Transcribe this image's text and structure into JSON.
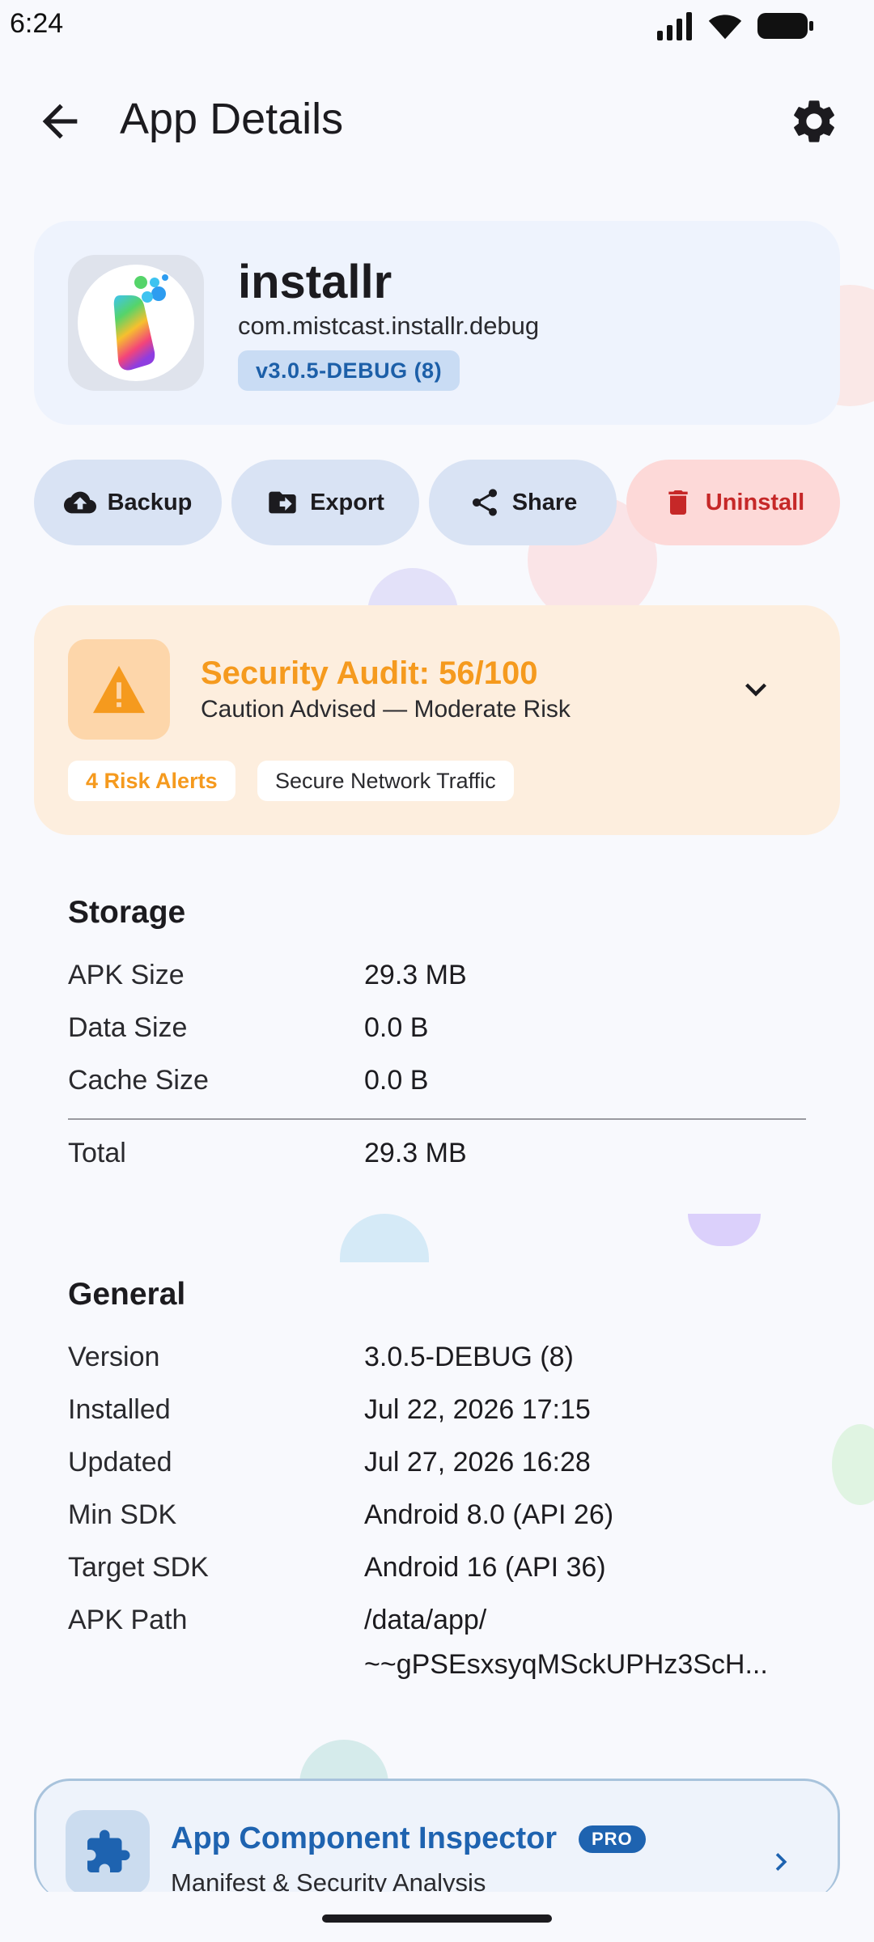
{
  "status_bar": {
    "time": "6:24"
  },
  "app_bar": {
    "title": "App Details",
    "back_icon": "arrow-back-icon",
    "settings_icon": "gear-icon"
  },
  "app": {
    "name": "installr",
    "package": "com.mistcast.installr.debug",
    "version_badge": "v3.0.5-DEBUG (8)"
  },
  "actions": [
    {
      "label": "Backup",
      "icon": "cloud-upload-icon"
    },
    {
      "label": "Export",
      "icon": "folder-export-icon"
    },
    {
      "label": "Share",
      "icon": "share-icon"
    },
    {
      "label": "Uninstall",
      "icon": "trash-icon",
      "color": "#c62828"
    }
  ],
  "security": {
    "title": "Security Audit: 56/100",
    "subtitle": "Caution Advised — Moderate Risk",
    "chips": [
      "4 Risk Alerts",
      "Secure Network Traffic"
    ],
    "accent": "#f59a1e"
  },
  "storage": {
    "title": "Storage",
    "rows": [
      {
        "label": "APK Size",
        "value": "29.3 MB"
      },
      {
        "label": "Data Size",
        "value": "0.0 B"
      },
      {
        "label": "Cache Size",
        "value": "0.0 B"
      }
    ],
    "total": {
      "label": "Total",
      "value": "29.3 MB"
    }
  },
  "general": {
    "title": "General",
    "rows": [
      {
        "label": "Version",
        "value": "3.0.5-DEBUG (8)"
      },
      {
        "label": "Installed",
        "value": "Jul 22, 2026 17:15"
      },
      {
        "label": "Updated",
        "value": "Jul 27, 2026 16:28"
      },
      {
        "label": "Min SDK",
        "value": "Android 8.0 (API 26)"
      },
      {
        "label": "Target SDK",
        "value": "Android 16 (API 36)"
      },
      {
        "label": "APK Path",
        "value": "/data/app/",
        "value_line2": "~~gPSEsxsyqMSckUPHz3ScH..."
      }
    ]
  },
  "inspector": {
    "title": "App Component Inspector",
    "badge": "PRO",
    "subtitle": "Manifest & Security Analysis",
    "accent": "#1e63b0"
  }
}
